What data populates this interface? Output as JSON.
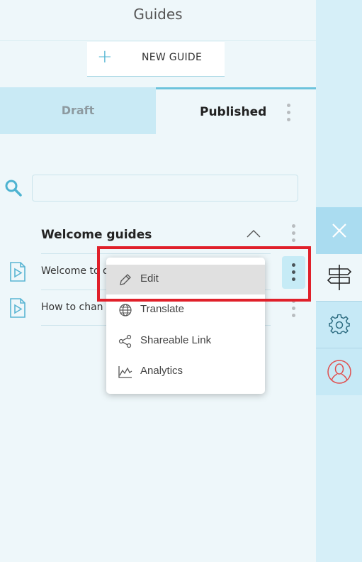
{
  "header": {
    "title": "Guides"
  },
  "new_guide_button": {
    "label": "NEW GUIDE"
  },
  "tabs": [
    {
      "label": "Draft",
      "active": false
    },
    {
      "label": "Published",
      "active": true
    }
  ],
  "search": {
    "placeholder": "",
    "value": ""
  },
  "group": {
    "title": "Welcome guides",
    "items": [
      {
        "label": "Welcome to o"
      },
      {
        "label": "How to chan"
      }
    ]
  },
  "context_menu": {
    "items": [
      {
        "label": "Edit",
        "icon": "pencil-icon",
        "highlighted": true
      },
      {
        "label": "Translate",
        "icon": "globe-icon"
      },
      {
        "label": "Shareable Link",
        "icon": "share-icon"
      },
      {
        "label": "Analytics",
        "icon": "analytics-icon"
      }
    ]
  },
  "colors": {
    "accent": "#4db3d1",
    "highlight_box": "#e0202a",
    "user_icon": "#e05050"
  }
}
